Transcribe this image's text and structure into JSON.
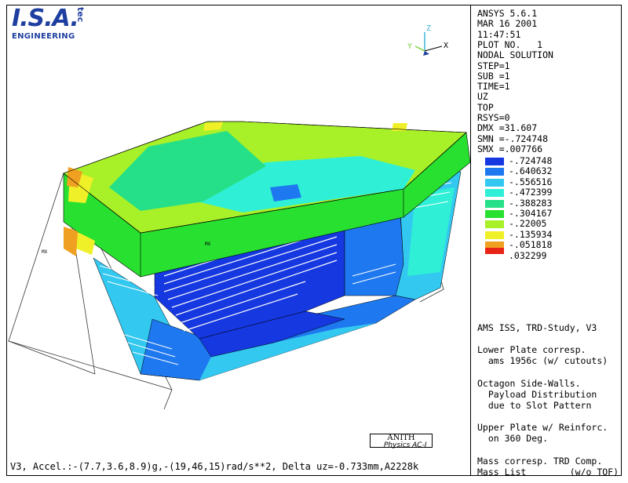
{
  "logo": {
    "main": "I.S.A.",
    "superscript": "tec",
    "sub": "ENGINEERING"
  },
  "axis_labels": {
    "y": "Y",
    "z": "Z",
    "x": "X"
  },
  "model_labels": {
    "a": "MX",
    "b": "MX"
  },
  "stamp": {
    "top": "ANITH",
    "bottom": "Physics AC-I"
  },
  "caption": "V3, Accel.:-(7.7,3.6,8.9)g,-(19,46,15)rad/s**2, Delta uz=-0.733mm,A2228k",
  "panel": {
    "header_lines": [
      "ANSYS 5.6.1",
      "MAR 16 2001",
      "11:47:51",
      "PLOT NO.   1",
      "NODAL SOLUTION",
      "STEP=1",
      "SUB =1",
      "TIME=1",
      "UZ",
      "TOP",
      "RSYS=0",
      "DMX =31.607",
      "SMN =-.724748",
      "SMX =.007766"
    ],
    "legend": [
      {
        "value": "-.724748",
        "color": "#1538e0"
      },
      {
        "value": "-.640632",
        "color": "#1e78f0"
      },
      {
        "value": "-.556516",
        "color": "#33c8f0"
      },
      {
        "value": "-.472399",
        "color": "#2ff0d6"
      },
      {
        "value": "-.388283",
        "color": "#25e088"
      },
      {
        "value": "-.304167",
        "color": "#28e030"
      },
      {
        "value": "-.22005",
        "color": "#a8f028"
      },
      {
        "value": "-.135934",
        "color": "#f0f028"
      },
      {
        "value": "-.051818",
        "color": "#f0a020"
      },
      {
        "value": ".032299",
        "color": "#e82418"
      }
    ],
    "notes": [
      [
        "AMS ISS, TRD-Study, V3"
      ],
      [
        "Lower Plate corresp.",
        "  ams 1956c (w/ cutouts)"
      ],
      [
        "Octagon Side-Walls.",
        "  Payload Distribution",
        "  due to Slot Pattern"
      ],
      [
        "Upper Plate w/ Reinforc.",
        "  on 360 Deg."
      ],
      [
        "Mass corresp. TRD Comp.",
        "Mass List        (w/o TOF)"
      ]
    ]
  }
}
